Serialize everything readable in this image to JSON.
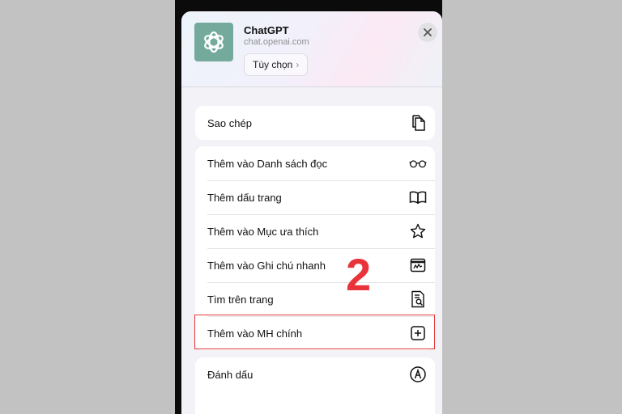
{
  "header": {
    "app_name": "ChatGPT",
    "url": "chat.openai.com",
    "options_label": "Tùy chọn",
    "options_chevron": "›"
  },
  "groups": [
    {
      "items": [
        {
          "label": "Sao chép",
          "icon": "copy-icon"
        }
      ]
    },
    {
      "items": [
        {
          "label": "Thêm vào Danh sách đọc",
          "icon": "reading-glasses-icon"
        },
        {
          "label": "Thêm dấu trang",
          "icon": "book-icon"
        },
        {
          "label": "Thêm vào Mục ưa thích",
          "icon": "star-icon"
        },
        {
          "label": "Thêm vào Ghi chú nhanh",
          "icon": "quick-note-icon"
        },
        {
          "label": "Tìm trên trang",
          "icon": "find-in-page-icon"
        },
        {
          "label": "Thêm vào MH chính",
          "icon": "add-square-icon"
        }
      ]
    },
    {
      "items": [
        {
          "label": "Đánh dấu",
          "icon": "markup-pen-icon"
        }
      ]
    }
  ],
  "annotation": {
    "step_number": "2",
    "color": "#e8333b"
  },
  "colors": {
    "app_icon_bg": "#74aa9c",
    "highlight_border": "#e43b3b"
  }
}
